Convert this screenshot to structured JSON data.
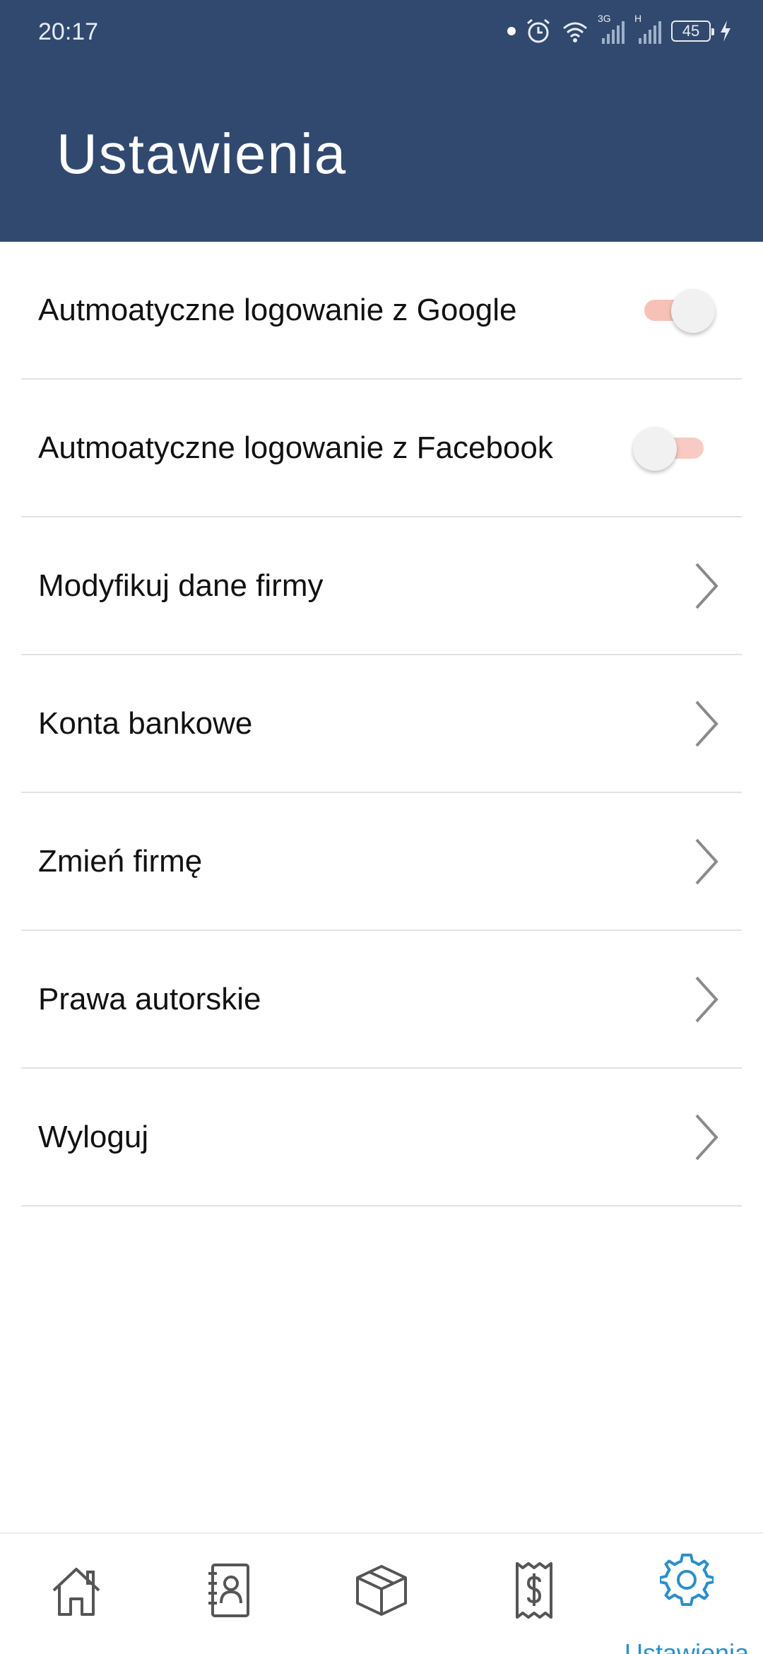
{
  "status_bar": {
    "time": "20:17",
    "signal1_label": "3G",
    "signal2_label": "H",
    "battery": "45"
  },
  "header": {
    "title": "Ustawienia"
  },
  "settings": {
    "google_login": {
      "label": "Autmoatyczne logowanie z Google",
      "enabled": true
    },
    "facebook_login": {
      "label": "Autmoatyczne logowanie z Facebook",
      "enabled": false
    },
    "items": [
      {
        "label": "Modyfikuj dane firmy"
      },
      {
        "label": "Konta bankowe"
      },
      {
        "label": "Zmień firmę"
      },
      {
        "label": "Prawa autorskie"
      },
      {
        "label": "Wyloguj"
      }
    ]
  },
  "bottom_nav": {
    "items": [
      {
        "icon": "home-icon"
      },
      {
        "icon": "contacts-icon"
      },
      {
        "icon": "box-icon"
      },
      {
        "icon": "receipt-icon"
      },
      {
        "icon": "gear-icon",
        "label": "Ustawienia",
        "active": true
      }
    ]
  },
  "colors": {
    "header_bg": "#31496f",
    "accent": "#2a8fc9",
    "toggle_track": "#f7cbc3"
  }
}
